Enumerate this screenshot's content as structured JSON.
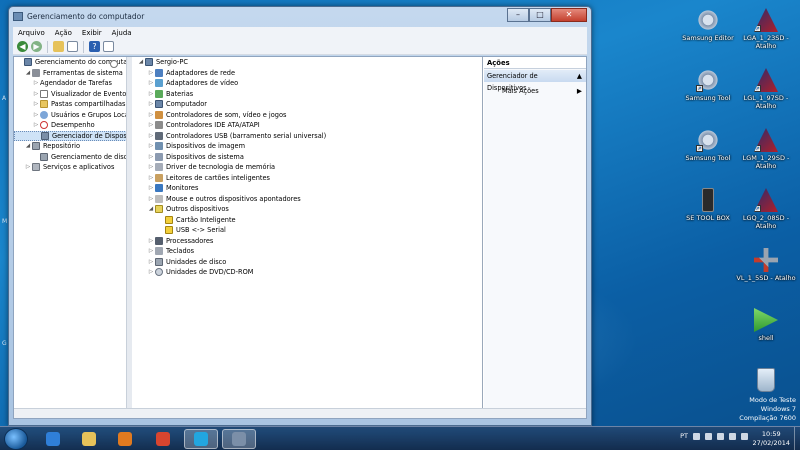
{
  "window": {
    "title": "Gerenciamento do computador",
    "caption": {
      "minimize": "–",
      "maximize": "□",
      "close": "✕"
    },
    "menu": [
      "Arquivo",
      "Ação",
      "Exibir",
      "Ajuda"
    ]
  },
  "left_tree": [
    {
      "label": "Gerenciamento do computador",
      "icon": "computer-management-icon",
      "indent": 0,
      "exp": ""
    },
    {
      "label": "Ferramentas de sistema",
      "icon": "tools-icon",
      "indent": 1,
      "exp": "◢"
    },
    {
      "label": "Agendador de Tarefas",
      "icon": "clock-icon",
      "indent": 2,
      "exp": "▷"
    },
    {
      "label": "Visualizador de Eventos",
      "icon": "event-log-icon",
      "indent": 2,
      "exp": "▷"
    },
    {
      "label": "Pastas compartilhadas",
      "icon": "shared-folder-icon",
      "indent": 2,
      "exp": "▷"
    },
    {
      "label": "Usuários e Grupos Loca",
      "icon": "users-icon",
      "indent": 2,
      "exp": "▷"
    },
    {
      "label": "Desempenho",
      "icon": "performance-icon",
      "indent": 2,
      "exp": "▷"
    },
    {
      "label": "Gerenciador de Disposit",
      "icon": "device-manager-icon",
      "indent": 2,
      "exp": "",
      "selected": true
    },
    {
      "label": "Repositório",
      "icon": "storage-icon",
      "indent": 1,
      "exp": "◢"
    },
    {
      "label": "Gerenciamento de disco",
      "icon": "disk-icon",
      "indent": 2,
      "exp": ""
    },
    {
      "label": "Serviços e aplicativos",
      "icon": "services-icon",
      "indent": 1,
      "exp": "▷"
    }
  ],
  "device_tree": [
    {
      "label": "Sergio-PC",
      "icon": "pc",
      "indent": 0,
      "exp": "◢"
    },
    {
      "label": "Adaptadores de rede",
      "icon": "net",
      "indent": 1,
      "exp": "▷"
    },
    {
      "label": "Adaptadores de vídeo",
      "icon": "video",
      "indent": 1,
      "exp": "▷"
    },
    {
      "label": "Baterias",
      "icon": "bat",
      "indent": 1,
      "exp": "▷"
    },
    {
      "label": "Computador",
      "icon": "pc",
      "indent": 1,
      "exp": "▷"
    },
    {
      "label": "Controladores de som, vídeo e jogos",
      "icon": "sound",
      "indent": 1,
      "exp": "▷"
    },
    {
      "label": "Controladores IDE ATA/ATAPI",
      "icon": "ide",
      "indent": 1,
      "exp": "▷"
    },
    {
      "label": "Controladores USB (barramento serial universal)",
      "icon": "usb",
      "indent": 1,
      "exp": "▷"
    },
    {
      "label": "Dispositivos de imagem",
      "icon": "image",
      "indent": 1,
      "exp": "▷"
    },
    {
      "label": "Dispositivos de sistema",
      "icon": "sys",
      "indent": 1,
      "exp": "▷"
    },
    {
      "label": "Driver de tecnologia de memória",
      "icon": "mem",
      "indent": 1,
      "exp": "▷"
    },
    {
      "label": "Leitores de cartões inteligentes",
      "icon": "card",
      "indent": 1,
      "exp": "▷"
    },
    {
      "label": "Monitores",
      "icon": "mon",
      "indent": 1,
      "exp": "▷"
    },
    {
      "label": "Mouse e outros dispositivos apontadores",
      "icon": "mouse",
      "indent": 1,
      "exp": "▷"
    },
    {
      "label": "Outros dispositivos",
      "icon": "other",
      "indent": 1,
      "exp": "◢"
    },
    {
      "label": "Cartão Inteligente",
      "icon": "warn",
      "indent": 2,
      "exp": ""
    },
    {
      "label": "USB <-> Serial",
      "icon": "warn",
      "indent": 2,
      "exp": ""
    },
    {
      "label": "Processadores",
      "icon": "cpu",
      "indent": 1,
      "exp": "▷"
    },
    {
      "label": "Teclados",
      "icon": "kbd",
      "indent": 1,
      "exp": "▷"
    },
    {
      "label": "Unidades de disco",
      "icon": "disk",
      "indent": 1,
      "exp": "▷"
    },
    {
      "label": "Unidades de DVD/CD-ROM",
      "icon": "dvd",
      "indent": 1,
      "exp": "▷"
    }
  ],
  "actions": {
    "header": "Ações",
    "section": "Gerenciador de Dispositivos",
    "more": "Mais Ações",
    "collapse_glyph": "▲",
    "more_glyph": "▶"
  },
  "desktop_icons": [
    {
      "label": "Samsung Editor",
      "kind": "gear",
      "shortcut": false
    },
    {
      "label": "LGA_1_23SD - Atalho",
      "kind": "lg",
      "shortcut": true
    },
    {
      "label": "Samsung Tool",
      "kind": "gear",
      "shortcut": true
    },
    {
      "label": "LGL_1_97SD - Atalho",
      "kind": "lg",
      "shortcut": true
    },
    {
      "label": "Samsung Tool",
      "kind": "gear",
      "shortcut": true
    },
    {
      "label": "LGM_1_29SD - Atalho",
      "kind": "lg",
      "shortcut": true
    },
    {
      "label": "SE TOOL BOX",
      "kind": "phone",
      "shortcut": false
    },
    {
      "label": "LGQ_2_08SD - Atalho",
      "kind": "lg",
      "shortcut": true
    },
    {
      "label": "VL_1_5SD - Atalho",
      "kind": "tools",
      "shortcut": true
    },
    {
      "label": "shell",
      "kind": "shell",
      "shortcut": false
    },
    {
      "label": "Lixeira",
      "kind": "trash",
      "shortcut": false
    }
  ],
  "watermark": [
    "Modo de Teste",
    "Windows 7",
    "Compilação 7600"
  ],
  "taskbar": {
    "apps": [
      {
        "name": "internet-explorer",
        "color": "#2f7fd8"
      },
      {
        "name": "explorer-folder",
        "color": "#e6c25a"
      },
      {
        "name": "media-player",
        "color": "#e07a20"
      },
      {
        "name": "chrome",
        "color": "#d8452f"
      },
      {
        "name": "skype",
        "color": "#22a6e0"
      },
      {
        "name": "computer-management",
        "color": "#7b8fa8"
      }
    ],
    "lang": "PT",
    "time": "10:59",
    "date": "27/02/2014"
  },
  "edge_letters": [
    "A",
    "M",
    "G"
  ]
}
